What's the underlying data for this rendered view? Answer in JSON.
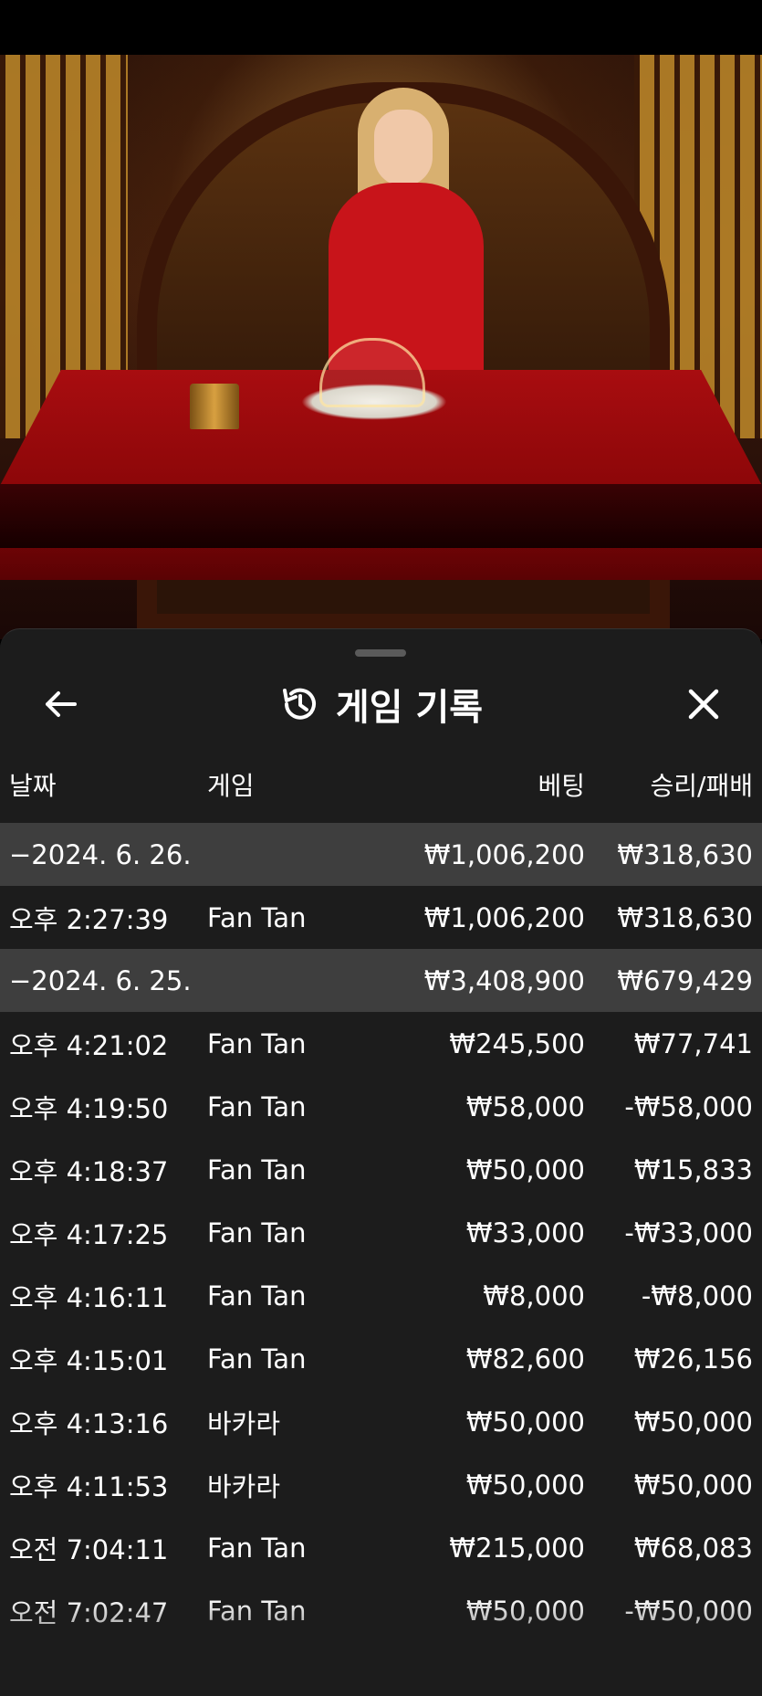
{
  "sheet": {
    "title": "게임 기록",
    "columns": {
      "date": "날짜",
      "game": "게임",
      "bet": "베팅",
      "winloss": "승리/패배"
    }
  },
  "records": [
    {
      "type": "group",
      "date": "−2024. 6. 26.",
      "game": "",
      "bet": "₩1,006,200",
      "winloss": "₩318,630"
    },
    {
      "type": "item",
      "date": "오후 2:27:39",
      "game": "Fan Tan",
      "bet": "₩1,006,200",
      "winloss": "₩318,630"
    },
    {
      "type": "group",
      "date": "−2024. 6. 25.",
      "game": "",
      "bet": "₩3,408,900",
      "winloss": "₩679,429"
    },
    {
      "type": "item",
      "date": "오후 4:21:02",
      "game": "Fan Tan",
      "bet": "₩245,500",
      "winloss": "₩77,741"
    },
    {
      "type": "item",
      "date": "오후 4:19:50",
      "game": "Fan Tan",
      "bet": "₩58,000",
      "winloss": "-₩58,000"
    },
    {
      "type": "item",
      "date": "오후 4:18:37",
      "game": "Fan Tan",
      "bet": "₩50,000",
      "winloss": "₩15,833"
    },
    {
      "type": "item",
      "date": "오후 4:17:25",
      "game": "Fan Tan",
      "bet": "₩33,000",
      "winloss": "-₩33,000"
    },
    {
      "type": "item",
      "date": "오후 4:16:11",
      "game": "Fan Tan",
      "bet": "₩8,000",
      "winloss": "-₩8,000"
    },
    {
      "type": "item",
      "date": "오후 4:15:01",
      "game": "Fan Tan",
      "bet": "₩82,600",
      "winloss": "₩26,156"
    },
    {
      "type": "item",
      "date": "오후 4:13:16",
      "game": "바카라",
      "bet": "₩50,000",
      "winloss": "₩50,000"
    },
    {
      "type": "item",
      "date": "오후 4:11:53",
      "game": "바카라",
      "bet": "₩50,000",
      "winloss": "₩50,000"
    },
    {
      "type": "item",
      "date": "오전 7:04:11",
      "game": "Fan Tan",
      "bet": "₩215,000",
      "winloss": "₩68,083"
    },
    {
      "type": "item",
      "date": "오전 7:02:47",
      "game": "Fan Tan",
      "bet": "₩50,000",
      "winloss": "-₩50,000"
    }
  ]
}
